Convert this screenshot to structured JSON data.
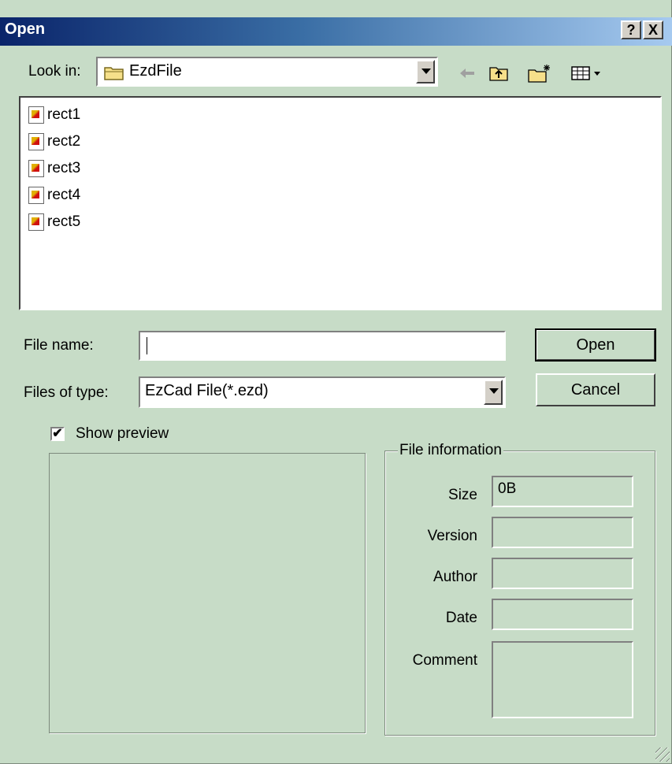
{
  "window": {
    "title": "Open",
    "help_label": "?",
    "close_label": "X"
  },
  "look_in": {
    "label": "Look in:",
    "value": "EzdFile",
    "icon": "folder-icon"
  },
  "toolbar": {
    "icons": [
      "back-arrow-icon",
      "up-folder-icon",
      "new-folder-icon",
      "view-menu-icon"
    ]
  },
  "files": [
    "rect1",
    "rect2",
    "rect3",
    "rect4",
    "rect5"
  ],
  "file_name": {
    "label": "File name:",
    "value": ""
  },
  "file_type": {
    "label": "Files of type:",
    "value": "EzCad File(*.ezd)"
  },
  "buttons": {
    "open": "Open",
    "cancel": "Cancel"
  },
  "preview": {
    "label": "Show preview",
    "checked": true
  },
  "file_info": {
    "title": "File information",
    "size_label": "Size",
    "size_value": "0B",
    "version_label": "Version",
    "version_value": "",
    "author_label": "Author",
    "author_value": "",
    "date_label": "Date",
    "date_value": "",
    "comment_label": "Comment",
    "comment_value": ""
  },
  "colors": {
    "dialog_bg": "#c7dcc7",
    "title_start": "#0a246a",
    "title_end": "#a6caf0"
  }
}
